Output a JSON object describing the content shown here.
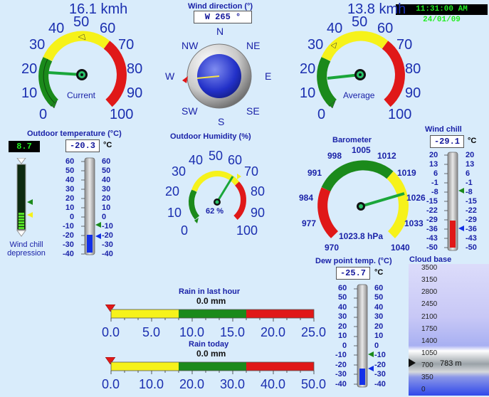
{
  "clock": {
    "text": "11:31:00 AM 24/01/09",
    "bg": "#000000",
    "fg": "#22ee22"
  },
  "wind_current": {
    "speed_text": "16.1 kmh",
    "label": "Current",
    "value": 16.1,
    "ticks": [
      "0",
      "10",
      "20",
      "30",
      "40",
      "50",
      "60",
      "70",
      "80",
      "90",
      "100"
    ]
  },
  "wind_average": {
    "speed_text": "13.8 kmh",
    "label": "Average",
    "value": 13.8,
    "ticks": [
      "0",
      "10",
      "20",
      "30",
      "40",
      "50",
      "60",
      "70",
      "80",
      "90",
      "100"
    ]
  },
  "wind_direction": {
    "title": "Wind direction (°)",
    "value_text": "W  265 °",
    "degrees": 265,
    "points": [
      "N",
      "NE",
      "E",
      "SE",
      "S",
      "SW",
      "W",
      "NW"
    ]
  },
  "outdoor_temperature": {
    "title": "Outdoor temperature (°C)",
    "value_text": "-20.3",
    "unit": "°C",
    "value": -20.3,
    "scale_left": [
      "60",
      "50",
      "40",
      "30",
      "20",
      "10",
      "0",
      "-10",
      "-20",
      "-30",
      "-40"
    ],
    "scale_right": [
      "60",
      "50",
      "40",
      "30",
      "20",
      "10",
      "0",
      "-10",
      "-20",
      "-30",
      "-40"
    ]
  },
  "wind_chill_depression": {
    "value_text": "8.7",
    "label_line1": "Wind chill",
    "label_line2": "depression",
    "fraction": 0.28
  },
  "outdoor_humidity": {
    "title": "Outdoor Humidity (%)",
    "value_text": "62 %",
    "value": 62,
    "ticks": [
      "0",
      "10",
      "20",
      "30",
      "40",
      "50",
      "60",
      "70",
      "80",
      "90",
      "100"
    ]
  },
  "barometer": {
    "title": "Barometer",
    "value_text": "1023.8 hPa",
    "value": 1023.8,
    "ticks": [
      "970",
      "977",
      "984",
      "991",
      "998",
      "1005",
      "1012",
      "1019",
      "1026",
      "1033",
      "1040"
    ]
  },
  "wind_chill": {
    "title": "Wind chill",
    "value_text": "-29.1",
    "unit": "°C",
    "value": -29.1,
    "scale_left": [
      "20",
      "13",
      "6",
      "-1",
      "-8",
      "-15",
      "-22",
      "-29",
      "-36",
      "-43",
      "-50"
    ],
    "scale_right": [
      "20",
      "13",
      "6",
      "-1",
      "-8",
      "-15",
      "-22",
      "-29",
      "-36",
      "-43",
      "-50"
    ]
  },
  "dew_point": {
    "title": "Dew point temp. (°C)",
    "value_text": "-25.7",
    "unit": "°C",
    "value": -25.7,
    "scale_left": [
      "60",
      "50",
      "40",
      "30",
      "20",
      "10",
      "0",
      "-10",
      "-20",
      "-30",
      "-40"
    ],
    "scale_right": [
      "60",
      "50",
      "40",
      "30",
      "20",
      "10",
      "0",
      "-10",
      "-20",
      "-30",
      "-40"
    ]
  },
  "rain_last_hour": {
    "title": "Rain in last hour",
    "value_text": "0.0 mm",
    "value": 0.0,
    "ticks": [
      "0.0",
      "5.0",
      "10.0",
      "15.0",
      "20.0",
      "25.0"
    ]
  },
  "rain_today": {
    "title": "Rain today",
    "value_text": "0.0 mm",
    "value": 0.0,
    "ticks": [
      "0.0",
      "10.0",
      "20.0",
      "30.0",
      "40.0",
      "50.0"
    ]
  },
  "cloud_base": {
    "title": "Cloud base",
    "value_text": "783 m",
    "value": 783,
    "ticks": [
      "3500",
      "3150",
      "2800",
      "2450",
      "2100",
      "1750",
      "1400",
      "1050",
      "700",
      "350",
      "0"
    ]
  },
  "colors": {
    "accent": "#1a22a8",
    "green": "#1b8a1b",
    "yellow": "#f6f21a",
    "red": "#e01818",
    "mercury": "#1230e8"
  }
}
